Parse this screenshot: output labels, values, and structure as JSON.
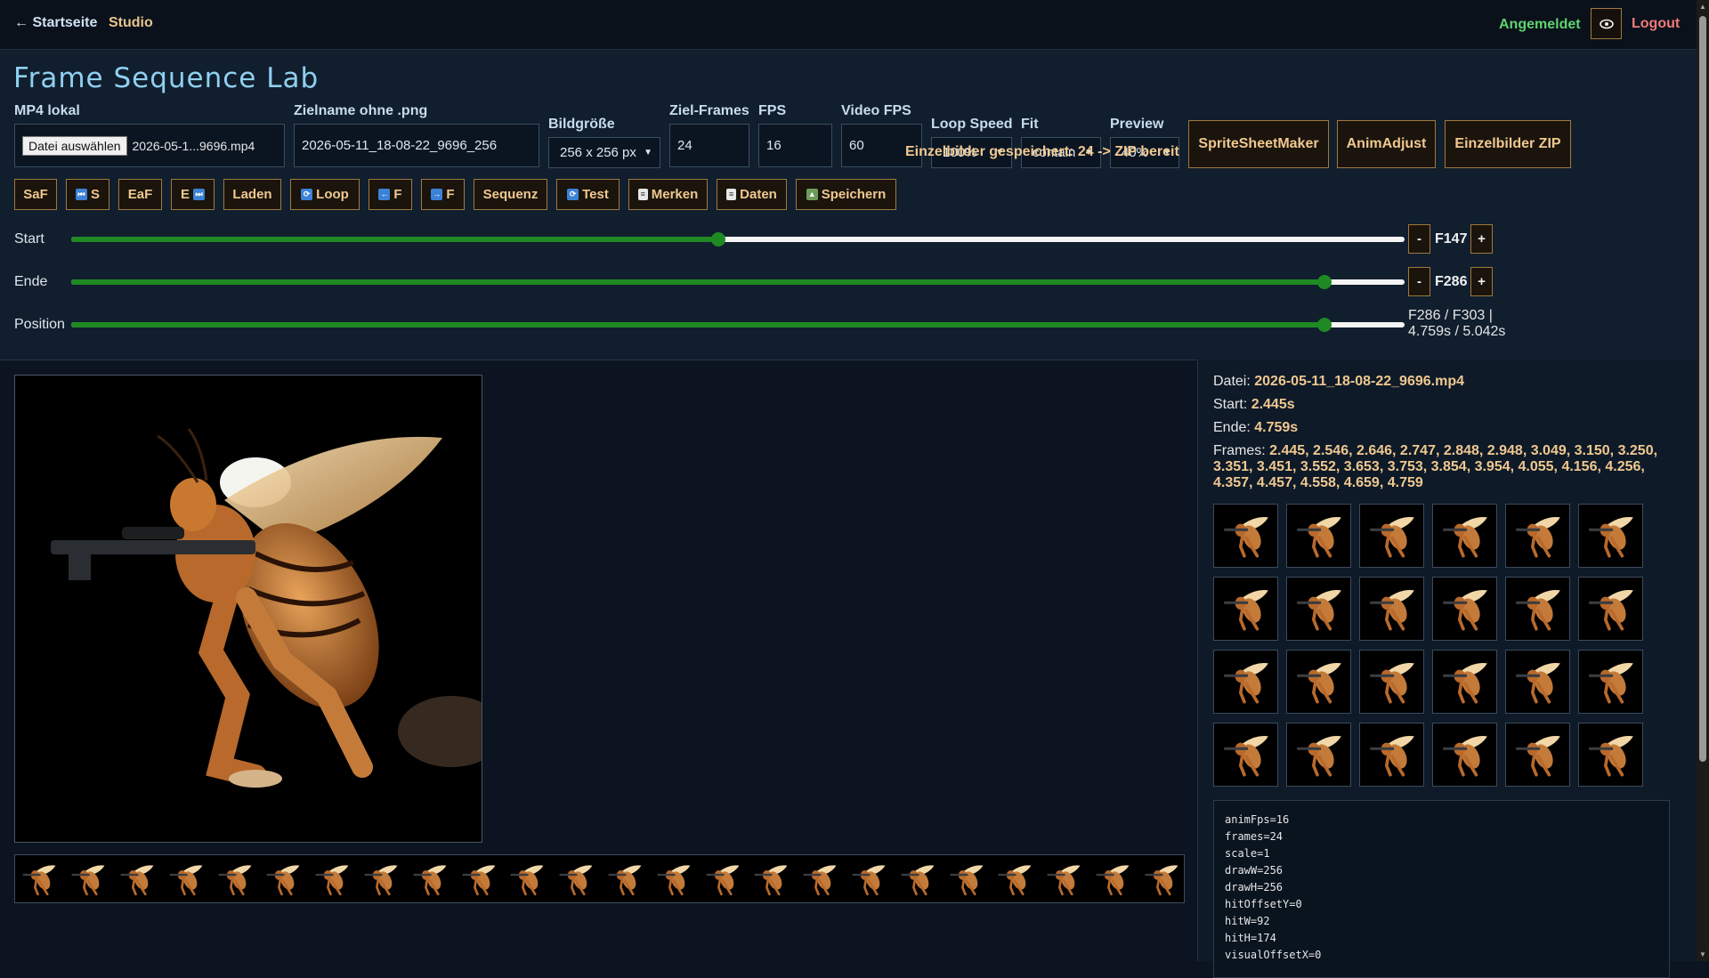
{
  "nav": {
    "home": "← Startseite",
    "studio": "Studio",
    "status": "Angemeldet",
    "logout": "Logout"
  },
  "title": "Frame Sequence Lab",
  "labels": {
    "mp4": "MP4 lokal",
    "zielname": "Zielname ohne .png",
    "bildgroesse": "Bildgröße",
    "zielframes": "Ziel-Frames",
    "fps": "FPS",
    "videofps": "Video FPS",
    "loopspeed": "Loop Speed",
    "fit": "Fit",
    "preview": "Preview"
  },
  "inputs": {
    "file_button": "Datei auswählen",
    "file_name": "2026-05-1...9696.mp4",
    "zielname": "2026-05-11_18-08-22_9696_256",
    "bildgroesse": "256 x 256 px",
    "zielframes": "24",
    "fps": "16",
    "videofps": "60",
    "loopspeed": "100%",
    "fit": "contain",
    "preview": "40%"
  },
  "big_buttons": {
    "spritesheet": "SpriteSheetMaker",
    "animadjust": "AnimAdjust",
    "einzelzip": "Einzelbilder ZIP"
  },
  "toolbar": {
    "saf": "SaF",
    "s": "S",
    "eaf": "EaF",
    "e": "E",
    "laden": "Laden",
    "loop": "Loop",
    "fback": "F",
    "ffwd": "F",
    "sequenz": "Sequenz",
    "test": "Test",
    "merken": "Merken",
    "daten": "Daten",
    "speichern": "Speichern"
  },
  "status_message": "Einzelbilder gespeichert: 24 -> ZIP bereit",
  "sliders": {
    "start_label": "Start",
    "ende_label": "Ende",
    "position_label": "Position",
    "start_frame": "F147",
    "ende_frame": "F286",
    "start_fraction": 0.485,
    "ende_fraction": 0.94,
    "position_fraction": 0.94,
    "minus": "-",
    "plus": "+",
    "position_line1": "F286 / F303 |",
    "position_line2": "4.759s / 5.042s"
  },
  "info": {
    "datei_label": "Datei:",
    "datei_value": "2026-05-11_18-08-22_9696.mp4",
    "start_label": "Start:",
    "start_value": "2.445s",
    "ende_label": "Ende:",
    "ende_value": "4.759s",
    "frames_label": "Frames:",
    "frames_value": "2.445, 2.546, 2.646, 2.747, 2.848, 2.948, 3.049, 3.150, 3.250, 3.351, 3.451, 3.552, 3.653, 3.753, 3.854, 3.954, 4.055, 4.156, 4.256, 4.357, 4.457, 4.558, 4.659, 4.759"
  },
  "data_lines": [
    "animFps=16",
    "frames=24",
    "scale=1",
    "drawW=256",
    "drawH=256",
    "hitOffsetY=0",
    "hitW=92",
    "hitH=174",
    "visualOffsetX=0"
  ],
  "colors": {
    "accent_gold": "#f0c890",
    "track_green": "#1f8a23",
    "status_green": "#5fd36f",
    "logout_red": "#f07a7a"
  },
  "icons": [
    "eye-icon",
    "rewind-icon",
    "forward-icon",
    "loop-icon",
    "arrow-left-icon",
    "arrow-right-icon",
    "test-icon",
    "clipboard-icon",
    "picture-icon",
    "chevron-down-icon"
  ]
}
